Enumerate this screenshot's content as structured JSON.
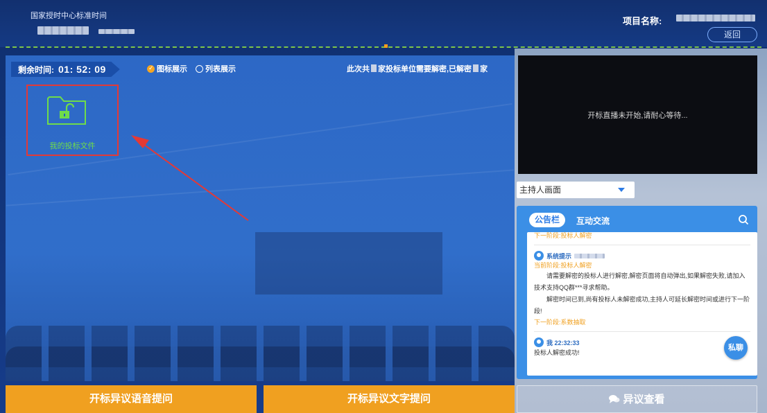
{
  "header": {
    "clock_title": "国家授时中心标准时间",
    "project_label": "项目名称:",
    "back_label": "返回"
  },
  "stage": {
    "timer_label": "剩余时间:",
    "timer_value": "01: 52: 09",
    "view_icon_label": "图标展示",
    "view_list_label": "列表展示",
    "decrypt_prefix": "此次共",
    "decrypt_middle": "家投标单位需要解密,已解密",
    "decrypt_suffix": "家",
    "file_label": "我的投标文件"
  },
  "actions": {
    "voice_label": "开标异议语音提问",
    "text_label": "开标异议文字提问",
    "view_label": "异议查看"
  },
  "live": {
    "status_text": "开标直播未开始,请耐心等待..."
  },
  "host_select": {
    "selected": "主持人画面"
  },
  "chat": {
    "tab_notice": "公告栏",
    "tab_interaction": "互动交流",
    "cut_stage": "下一阶段:投标人解密",
    "msg1_sender": "系统提示",
    "msg1_current": "当前阶段:投标人解密",
    "msg1_para1": "请需要解密的投标人进行解密,解密页面将自动弹出,如果解密失败,请加入技术支持QQ群***寻求帮助。",
    "msg1_para2": "解密时间已到,尚有投标人未解密成功,主持人可延长解密时间或进行下一阶段!",
    "msg1_next": "下一阶段:系数抽取",
    "msg2_sender": "我 22:32:33",
    "msg2_text": "投标人解密成功!",
    "private_label": "私聊"
  },
  "colors": {
    "accent_orange": "#f0a020",
    "accent_blue": "#3b8fe6",
    "highlight_red": "#e53935",
    "file_green": "#6fdc4a"
  }
}
